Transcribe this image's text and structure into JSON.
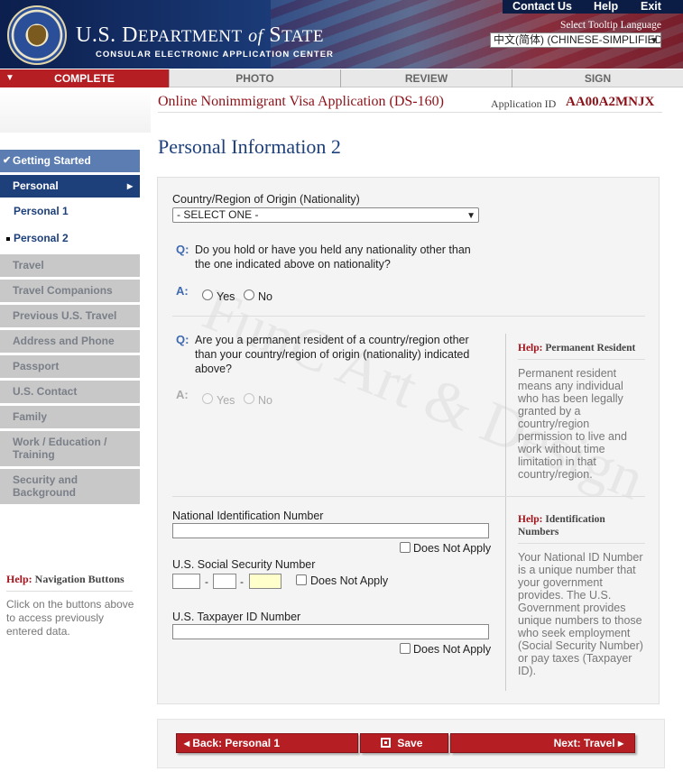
{
  "header": {
    "links": [
      "Contact Us",
      "Help",
      "Exit"
    ],
    "dept_title": "U.S. Department of State",
    "dept_subtitle": "CONSULAR ELECTRONIC APPLICATION CENTER",
    "tooltip_language_label": "Select Tooltip Language",
    "tooltip_language_value": "中文(简体)  (CHINESE-SIMPLIFIED)"
  },
  "steps": [
    "COMPLETE",
    "PHOTO",
    "REVIEW",
    "SIGN"
  ],
  "app": {
    "title": "Online Nonimmigrant Visa Application (DS-160)",
    "id_label": "Application ID",
    "id_value": "AA00A2MNJX"
  },
  "sidebar": {
    "items": [
      {
        "label": "Getting Started",
        "state": "complete"
      },
      {
        "label": "Personal",
        "state": "current"
      },
      {
        "label": "Personal 1",
        "state": "sub"
      },
      {
        "label": "Personal 2",
        "state": "sub-current"
      },
      {
        "label": "Travel",
        "state": "todo"
      },
      {
        "label": "Travel Companions",
        "state": "todo"
      },
      {
        "label": "Previous U.S. Travel",
        "state": "todo"
      },
      {
        "label": "Address and Phone",
        "state": "todo"
      },
      {
        "label": "Passport",
        "state": "todo"
      },
      {
        "label": "U.S. Contact",
        "state": "todo"
      },
      {
        "label": "Family",
        "state": "todo"
      },
      {
        "label": "Work / Education / Training",
        "state": "todo"
      },
      {
        "label": "Security and Background",
        "state": "todo"
      }
    ],
    "help_head_prefix": "Help:",
    "help_head": "Navigation Buttons",
    "help_body": "Click on the buttons above to access previously entered data."
  },
  "page_title": "Personal Information 2",
  "form": {
    "nationality_label": "Country/Region of Origin (Nationality)",
    "nationality_value": "- SELECT ONE -",
    "q1_mark": "Q:",
    "q1_text": "Do you hold or have you held any nationality other than the one indicated above on nationality?",
    "a_mark": "A:",
    "yes": "Yes",
    "no": "No",
    "q2_mark": "Q:",
    "q2_text": "Are you a permanent resident of a country/region other than your country/region of origin (nationality) indicated above?",
    "national_id_label": "National Identification Number",
    "ssn_label": "U.S. Social Security Number",
    "taxpayer_label": "U.S. Taxpayer ID Number",
    "does_not_apply": "Does Not Apply",
    "dash": "-"
  },
  "help": {
    "prefix": "Help:",
    "pr_title": "Permanent Resident",
    "pr_body": "Permanent resident means any individual who has been legally granted by a country/region permission to live and work without time limitation in that country/region.",
    "id_title": "Identification Numbers",
    "id_body": "Your National ID Number is a unique number that your government provides. The U.S. Government provides unique numbers to those who seek employment (Social Security Number) or pay taxes (Taxpayer ID)."
  },
  "watermark": "FunC Art & Design",
  "buttons": {
    "back": "Back: Personal 1",
    "save": "Save",
    "next": "Next: Travel"
  },
  "colors": {
    "brand_red": "#b51f24",
    "brand_navy": "#1d3f7a"
  }
}
